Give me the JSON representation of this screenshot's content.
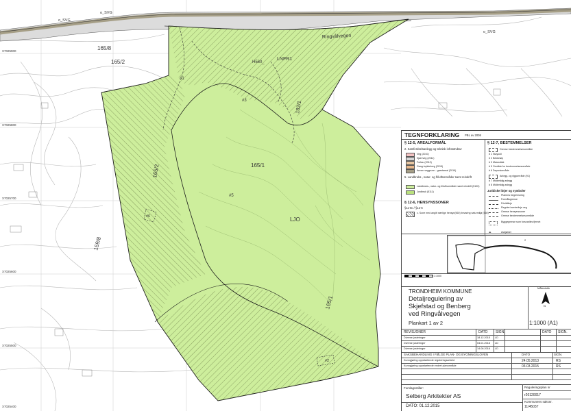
{
  "map": {
    "road_label": "Ringvålvegen",
    "svg_labels": [
      "o_SVG",
      "o_SVG",
      "o_SVG"
    ],
    "parcel_labels": [
      "165/8",
      "165/2",
      "165/2",
      "165/1",
      "165/1",
      "159/8",
      "182/1"
    ],
    "zone_labels": {
      "lnfr": "LNFR1",
      "h560": "H560_",
      "ljo": "LJO"
    },
    "marker_labels": [
      "#1",
      "#3",
      "#5",
      "#6",
      "#2"
    ],
    "coord_labels": [
      "X7025900",
      "X7025800",
      "X7025700",
      "X7025600",
      "X7025500",
      "X7025400"
    ],
    "colors": {
      "zone_fill": "#cdee9c",
      "zone_stroke": "#1a1a1a",
      "road_fill": "#a69f87",
      "contour": "#aaaaaa"
    }
  },
  "legend": {
    "title": "TEGNFORKLARING",
    "subtitle": "PBL av 2008",
    "left": {
      "s1_heading": "§ 12-5, AREALFORMÅL",
      "s1_sub": "2. Samferdselsanlegg og teknisk infrastruktur",
      "s1_items": [
        "Veg (2010)",
        "Kjøreveg (2011)",
        "Fortau (2012)",
        "Gang-/sykkelveg (2015)",
        "Annen veggrunn - grøntareal (2019)"
      ],
      "s2_sub": "5. Landbruks-, natur- og friluftsområder samt reindrift",
      "s2_items": [
        "Landbruks-, natur- og friluftsområder samt reindrift (5100)",
        "Jordbruk (5111)"
      ],
      "s3_heading": "§ 12-6, HENSYNSSONER",
      "s3_sub": "§11-8c / §12-6",
      "s3_items": [
        "c. Sone med angitt særlige hensyn(560) bevaring naturmiljø (560)"
      ]
    },
    "right": {
      "heading": "§ 12-7, BESTEMMELSER",
      "items": [
        "Grense bestemmelsesområde",
        "# 1 Støyvoll",
        "# 2 Bekkeløp",
        "# 3 Massuttak",
        "# 5 Område for bestemmelsesområde",
        "# 6 Deponiområde",
        "Anlegg- og riggområde (91)",
        "# 7 Midlertidig anlegg",
        "# 8 Midlertidig anlegg"
      ],
      "lines_heading": "Juridiske linjer og symboler",
      "lines": [
        "Planens begrensning",
        "Formålsgrense",
        "Frisiktlinje",
        "Regulert senterlinje veg",
        "Grense hensynssoner",
        "Grense bestemmelsesområde"
      ],
      "other": [
        "Byggegrense som forsvarlles fjernet",
        "Avkjørsel"
      ]
    },
    "scale_label": "1:1000"
  },
  "titleblock": {
    "municipality": "TRONDHEIM KOMMUNE",
    "plan_title_1": "Detaljregulering av",
    "plan_title_2": "Skjefstad og Benberg",
    "plan_title_3": "ved Ringvålvegen",
    "sheet": "Plankart 1 av 2",
    "scale_caption": "Målestokk",
    "scale": "1:1000 (A1)",
    "revisions_heading": "REVISJONER",
    "col_dato": "DATO",
    "col_sign": "SIGN.",
    "revisions": [
      {
        "text": "Diverse justeringer",
        "date": "18.12.2015",
        "sign": "LD"
      },
      {
        "text": "Diverse justeringer",
        "date": "04.01.2016",
        "sign": "LD"
      },
      {
        "text": "Diverse justeringer",
        "date": "14.06.2016",
        "sign": "LD"
      }
    ],
    "case_heading": "SAKSBEHANDLING I FØLGE PLAN- OG BYGNINGSLOVEN",
    "case_rows": [
      {
        "text": "Kunngjøring oppstartende reguleringsarbeid",
        "date": "24.05.2013",
        "sign": "RS"
      },
      {
        "text": "Kunngjøring oppstartende endret planområde",
        "date": "03.03.2015",
        "sign": "RS"
      }
    ],
    "proposer_label": "Forslagsstiller:",
    "proposer": "Selberg Arkitekter AS",
    "date_line": "DATO: 01.12.2015",
    "planid_label": "Reguleringsplan nr",
    "planid": "r20120017",
    "case_label": "Kommunens saksnr.",
    "case_no": "11/45037"
  }
}
